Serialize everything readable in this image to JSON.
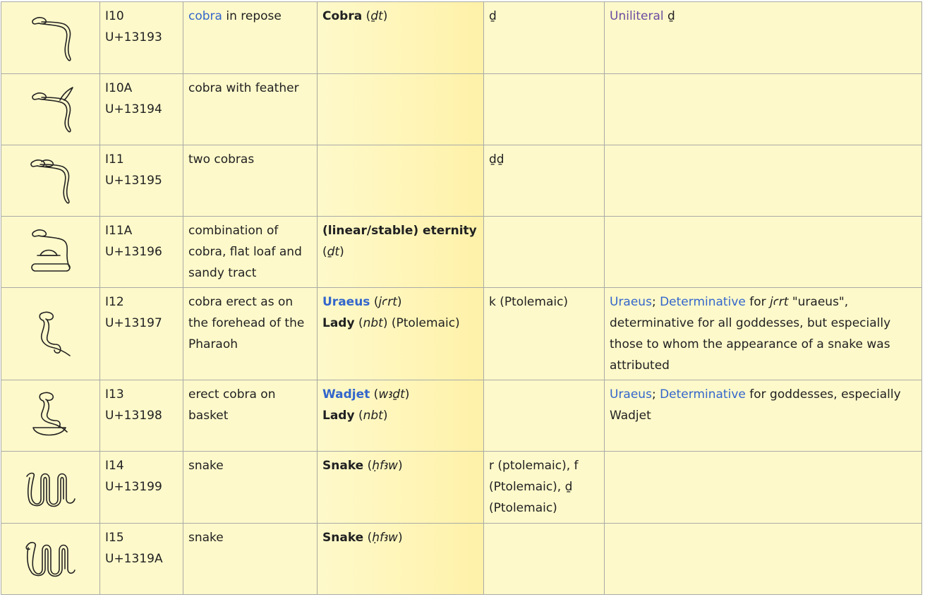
{
  "rows": [
    {
      "sign_icon": "cobra-in-repose-glyph",
      "code": "I10",
      "unicode": "U+13193",
      "desc_link": "cobra",
      "desc_rest": " in repose",
      "mean1_b": "Cobra",
      "mean1_open": " (",
      "mean1_i": "ḏt",
      "mean1_close": ")",
      "phonetic": "ḏ",
      "notes_link": "Uniliteral",
      "notes_rest": " ḏ"
    },
    {
      "sign_icon": "cobra-with-feather-glyph",
      "code": "I10A",
      "unicode": "U+13194",
      "desc": "cobra with feather"
    },
    {
      "sign_icon": "two-cobras-glyph",
      "code": "I11",
      "unicode": "U+13195",
      "desc": "two cobras",
      "phonetic": "ḏḏ"
    },
    {
      "sign_icon": "cobra-loaf-sandy-tract-glyph",
      "code": "I11A",
      "unicode": "U+13196",
      "desc": "combination of cobra, flat loaf and sandy tract",
      "mean1_b": "(linear/stable) eternity",
      "mean1_open": "(",
      "mean1_i": "ḏt",
      "mean1_close": ")"
    },
    {
      "sign_icon": "cobra-erect-glyph",
      "code": "I12",
      "unicode": "U+13197",
      "desc": "cobra erect as on the forehead of the Pharaoh",
      "mean1_link": "Uraeus",
      "mean1_open": " (",
      "mean1_i": "jꜥrt",
      "mean1_close": ")",
      "mean2_b": "Lady",
      "mean2_open": " (",
      "mean2_i": "nbt",
      "mean2_close": ") (Ptolemaic)",
      "phonetic": "k (Ptolemaic)",
      "notes_link1": "Uraeus",
      "notes_sep": "; ",
      "notes_link2": "Determinative",
      "notes_mid": " for ",
      "notes_i": "jꜥrt",
      "notes_rest": " \"uraeus\", determinative for all goddesses, but especially those to whom the appearance of a snake was attributed"
    },
    {
      "sign_icon": "cobra-on-basket-glyph",
      "code": "I13",
      "unicode": "U+13198",
      "desc": "erect cobra on basket",
      "mean1_link": "Wadjet",
      "mean1_open": " (",
      "mean1_i": "wꜣḏt",
      "mean1_close": ")",
      "mean2_b": "Lady",
      "mean2_open": " (",
      "mean2_i": "nbt",
      "mean2_close": ")",
      "notes_link1": "Uraeus",
      "notes_sep": "; ",
      "notes_link2": "Determinative",
      "notes_rest": " for goddesses, especially Wadjet"
    },
    {
      "sign_icon": "snake-glyph",
      "code": "I14",
      "unicode": "U+13199",
      "desc": "snake",
      "mean1_b": "Snake",
      "mean1_open": " (",
      "mean1_i": "ḥfꜣw",
      "mean1_close": ")",
      "phonetic": "r (ptolemaic), f (Ptolemaic), ḏ (Ptolemaic)"
    },
    {
      "sign_icon": "snake-variant-glyph",
      "code": "I15",
      "unicode": "U+1319A",
      "desc": "snake",
      "mean1_b": "Snake",
      "mean1_open": " (",
      "mean1_i": "ḥfꜣw",
      "mean1_close": ")"
    }
  ]
}
